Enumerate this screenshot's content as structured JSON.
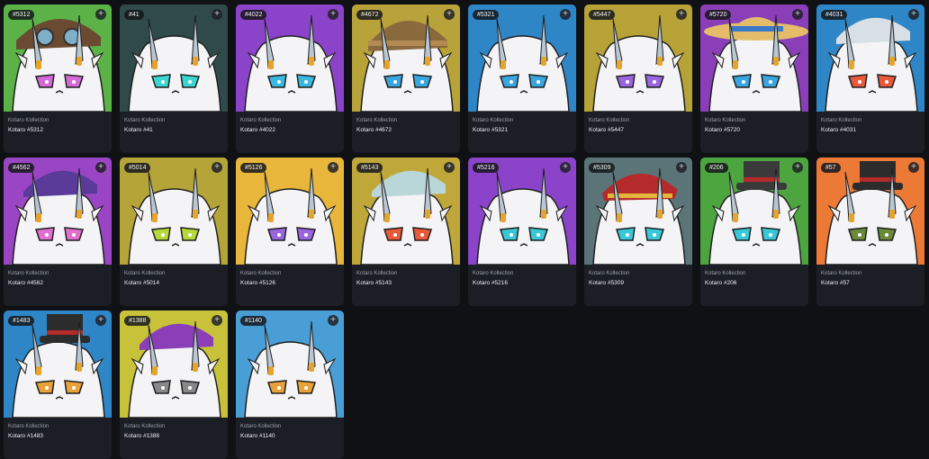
{
  "collection_label": "Kotaro Kollection",
  "add_icon_glyph": "+",
  "cards": [
    {
      "badge": "#5312",
      "name": "Kotaro #5312",
      "bg": "#5bb347",
      "hat": "goggles",
      "hatColor": "#6b4a32",
      "eye": "#d36ad8"
    },
    {
      "badge": "#41",
      "name": "Kotaro #41",
      "bg": "#2f4a48",
      "hat": "none",
      "hatColor": "#2f4a48",
      "eye": "#3ad6d0"
    },
    {
      "badge": "#4022",
      "name": "Kotaro #4022",
      "bg": "#8a43c9",
      "hat": "none",
      "hatColor": "#8a43c9",
      "eye": "#39b8e0"
    },
    {
      "badge": "#4672",
      "name": "Kotaro #4672",
      "bg": "#b8a23a",
      "hat": "helmet",
      "hatColor": "#8a6a3c",
      "eye": "#3aa6e0"
    },
    {
      "badge": "#5321",
      "name": "Kotaro #5321",
      "bg": "#2f86c6",
      "hat": "none",
      "hatColor": "#2f86c6",
      "eye": "#3aa6e0"
    },
    {
      "badge": "#5447",
      "name": "Kotaro #5447",
      "bg": "#b6a237",
      "hat": "none",
      "hatColor": "#b6a237",
      "eye": "#9a66e0"
    },
    {
      "badge": "#5720",
      "name": "Kotaro #5720",
      "bg": "#8a3fb8",
      "hat": "straw",
      "hatColor": "#e5bd6a",
      "eye": "#3aa6e0"
    },
    {
      "badge": "#4031",
      "name": "Kotaro #4031",
      "bg": "#2f86c6",
      "hat": "cap",
      "hatColor": "#d8dfe5",
      "eye": "#e85a3a"
    },
    {
      "badge": "#4562",
      "name": "Kotaro #4562",
      "bg": "#9a46c4",
      "hat": "cap",
      "hatColor": "#5a3b9a",
      "eye": "#e070d0"
    },
    {
      "badge": "#5014",
      "name": "Kotaro #5014",
      "bg": "#b5a438",
      "hat": "none",
      "hatColor": "#b5a438",
      "eye": "#b7d83a"
    },
    {
      "badge": "#5126",
      "name": "Kotaro #5126",
      "bg": "#e7b63a",
      "hat": "none",
      "hatColor": "#e7b63a",
      "eye": "#9a66e0"
    },
    {
      "badge": "#5143",
      "name": "Kotaro #5143",
      "bg": "#c0a73a",
      "hat": "cap",
      "hatColor": "#b9d6d8",
      "eye": "#e85a3a"
    },
    {
      "badge": "#5216",
      "name": "Kotaro #5216",
      "bg": "#8a43c9",
      "hat": "none",
      "hatColor": "#8a43c9",
      "eye": "#39c8d8"
    },
    {
      "badge": "#5309",
      "name": "Kotaro #5309",
      "bg": "#5a7478",
      "hat": "beret",
      "hatColor": "#b52a2a",
      "eye": "#39c8d8"
    },
    {
      "badge": "#206",
      "name": "Kotaro #206",
      "bg": "#4ca53f",
      "hat": "tophat",
      "hatColor": "#3a3a3a",
      "eye": "#39c8d8"
    },
    {
      "badge": "#57",
      "name": "Kotaro #57",
      "bg": "#ec7a36",
      "hat": "tophat",
      "hatColor": "#2c2c2c",
      "eye": "#6a8a3a"
    },
    {
      "badge": "#1483",
      "name": "Kotaro #1483",
      "bg": "#2f86c6",
      "hat": "tophat",
      "hatColor": "#2c2c2c",
      "eye": "#e8a23a"
    },
    {
      "badge": "#1388",
      "name": "Kotaro #1388",
      "bg": "#c7c23a",
      "hat": "cap",
      "hatColor": "#8a3fb8",
      "eye": "#888888"
    },
    {
      "badge": "#1140",
      "name": "Kotaro #1140",
      "bg": "#4a9ed6",
      "hat": "none",
      "hatColor": "#4a9ed6",
      "eye": "#e8a23a"
    }
  ]
}
